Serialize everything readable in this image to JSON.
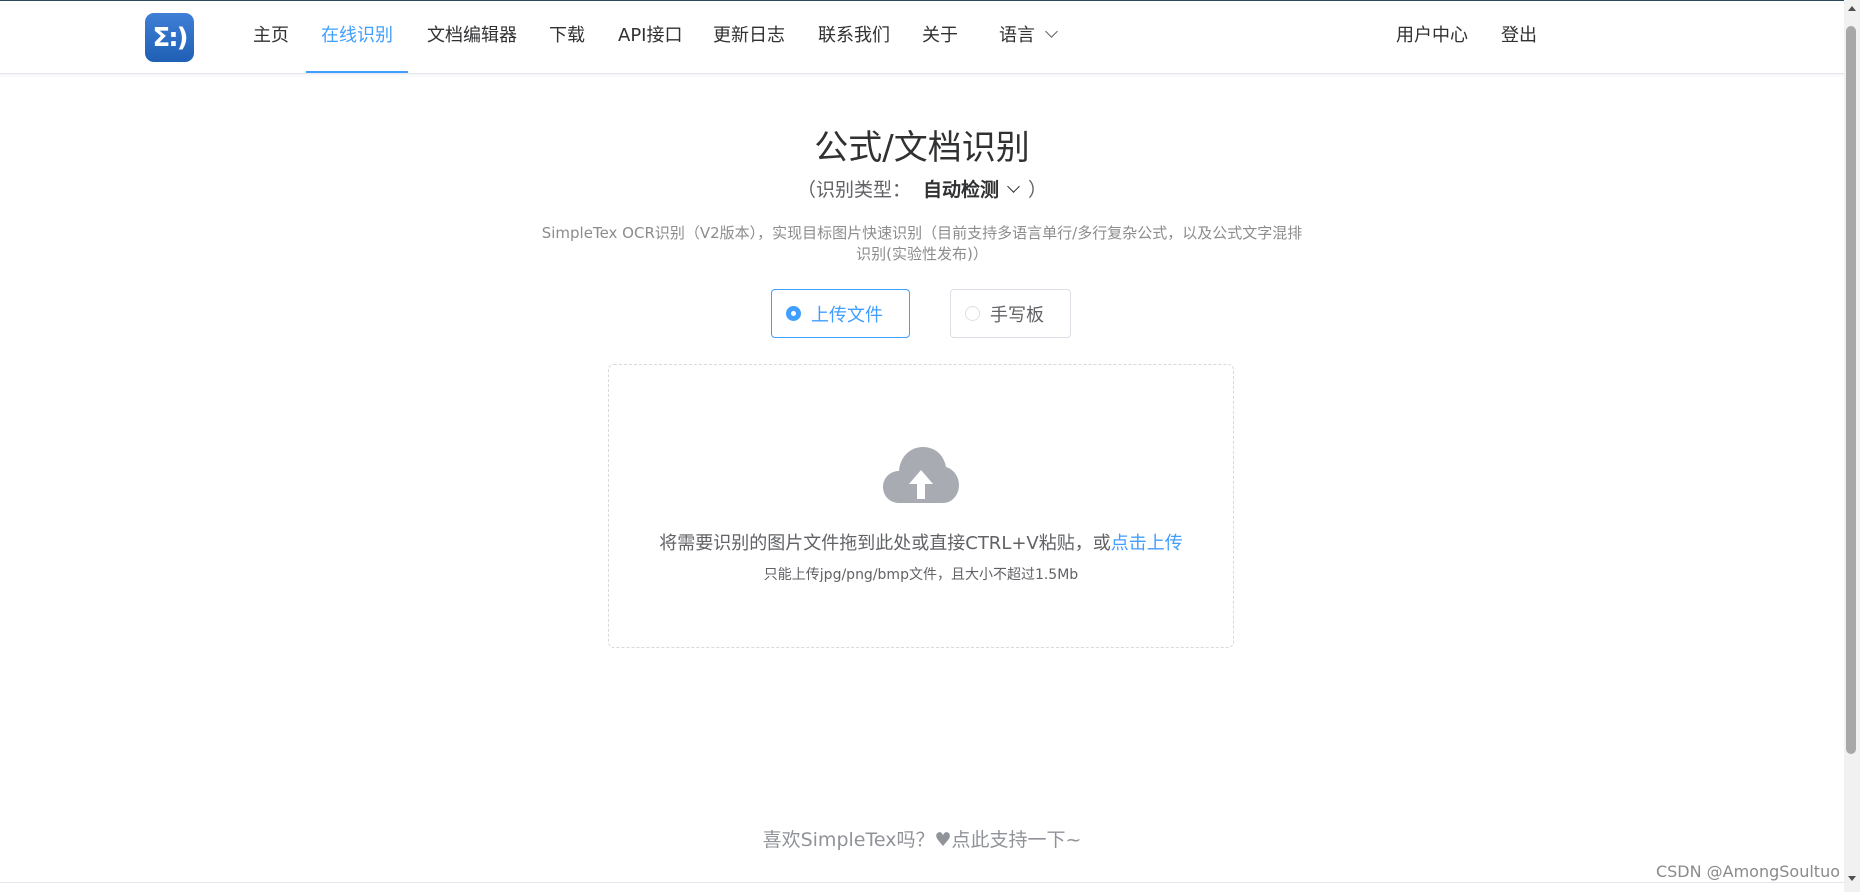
{
  "nav": {
    "logo_text": "Σ:)",
    "items": [
      {
        "label": "主页"
      },
      {
        "label": "在线识别"
      },
      {
        "label": "文档编辑器"
      },
      {
        "label": "下载"
      },
      {
        "label": "API接口"
      },
      {
        "label": "更新日志"
      },
      {
        "label": "联系我们"
      },
      {
        "label": "关于"
      }
    ],
    "language_label": "语言",
    "user_center": "用户中心",
    "logout": "登出",
    "active_index": 1
  },
  "main": {
    "title": "公式/文档识别",
    "type_open": "（",
    "type_prefix": "识别类型：",
    "type_value": "自动检测",
    "type_close": "）",
    "description": "SimpleTex OCR识别（V2版本），实现目标图片快速识别（目前支持多语言单行/多行复杂公式，以及公式文字混排识别(实验性发布)）",
    "modes": [
      {
        "label": "上传文件",
        "checked": true
      },
      {
        "label": "手写板",
        "checked": false
      }
    ],
    "upload": {
      "text": "将需要识别的图片文件拖到此处或直接CTRL+V粘贴，或",
      "link": "点击上传",
      "tip": "只能上传jpg/png/bmp文件，且大小不超过1.5Mb"
    }
  },
  "footer": {
    "support": "喜欢SimpleTex吗？♥点此支持一下~"
  },
  "watermark": "CSDN @AmongSoultuo",
  "colors": {
    "accent": "#409eff",
    "text": "#303133",
    "muted": "#909399",
    "logo": "#2a6cc6"
  },
  "icons": {
    "upload": "cloud-upload-icon",
    "language": "chevron-down-icon"
  }
}
